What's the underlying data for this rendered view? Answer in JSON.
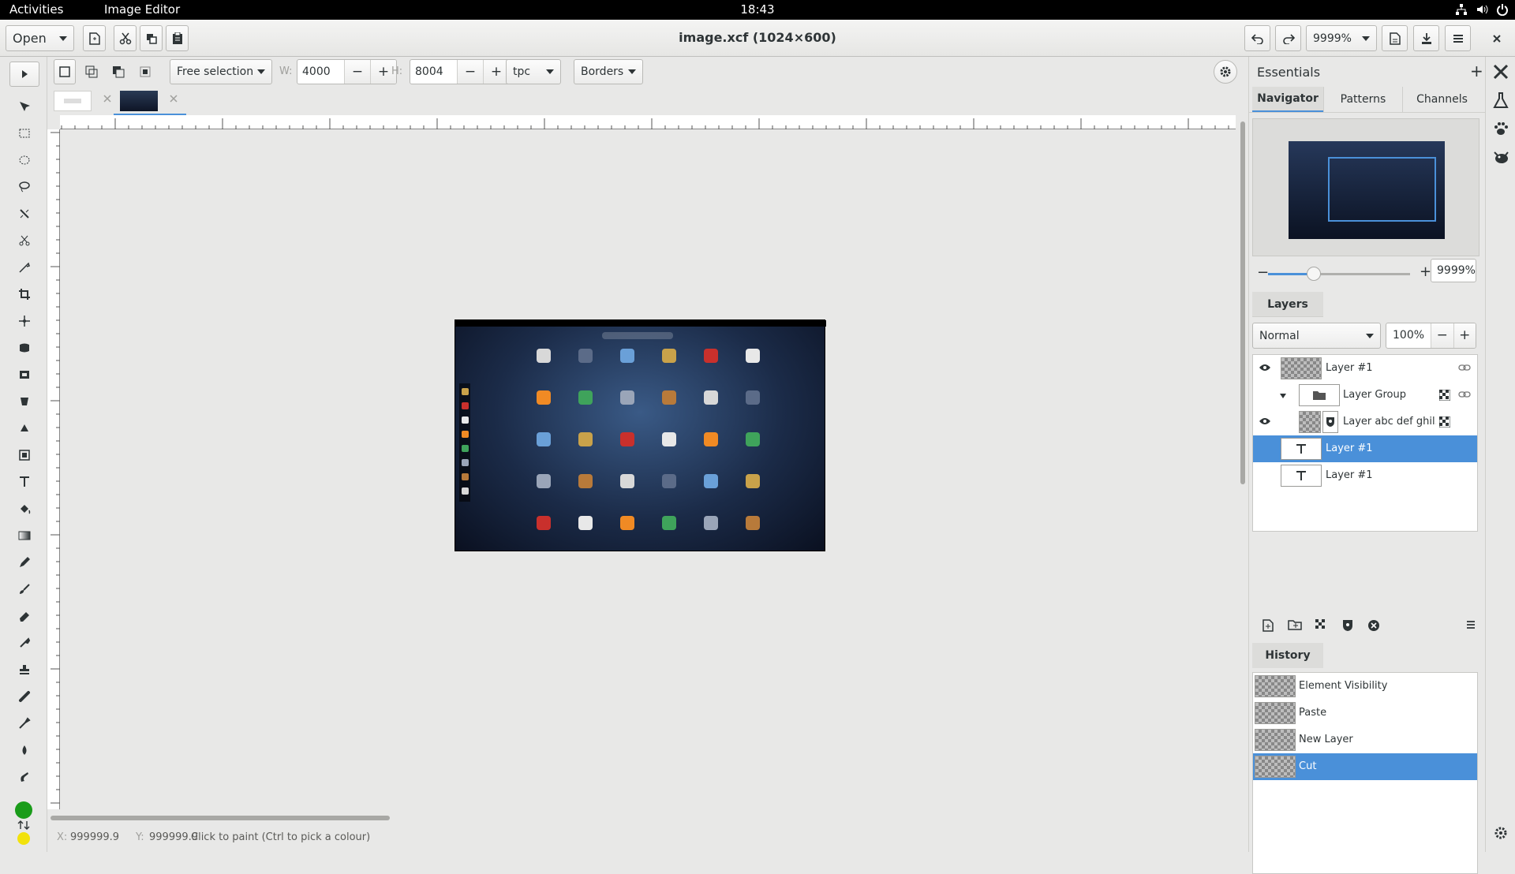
{
  "topbar": {
    "activities": "Activities",
    "app_name": "Image Editor",
    "clock": "18:43"
  },
  "header": {
    "open_label": "Open",
    "title": "image.xcf (1024×600)",
    "zoom": "9999%"
  },
  "options": {
    "selection_mode": "Free selection",
    "w_label": "W:",
    "w_value": "4000",
    "h_label": "H:",
    "h_value": "8004",
    "unit": "tpc",
    "borders": "Borders"
  },
  "dock": {
    "title": "Essentials",
    "tabs": [
      "Navigator",
      "Patterns",
      "Channels"
    ],
    "navigator_zoom": "9999%",
    "navigator_zoom_slider": 0.32,
    "layers_title": "Layers",
    "blend_mode": "Normal",
    "opacity": "100%",
    "layers": [
      "Layer #1",
      "Layer Group",
      "Layer abc def ghil...",
      "Layer #1",
      "Layer #1"
    ],
    "history_title": "History",
    "history": [
      "Element Visibility",
      "Paste",
      "New Layer",
      "Cut"
    ]
  },
  "status": {
    "x_label": "X:",
    "x_value": "999999.9",
    "y_label": "Y:",
    "y_value": "999999.9",
    "message": "Click to paint (Ctrl to pick a colour)"
  },
  "colors": {
    "accent": "#4a90d9",
    "foreground": "#1a9c1a",
    "background": "#f2e20c"
  }
}
